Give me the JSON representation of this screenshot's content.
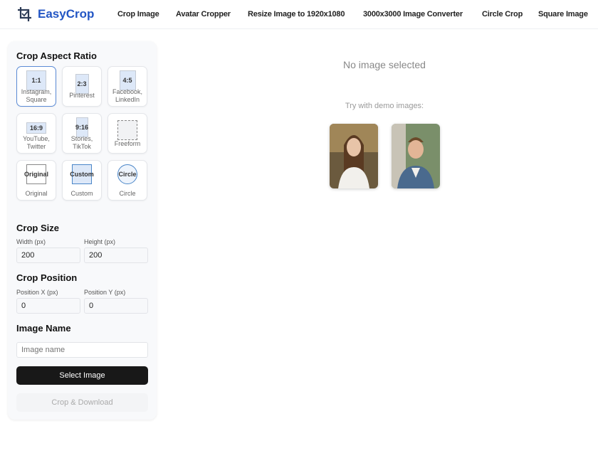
{
  "brand": {
    "name": "EasyCrop",
    "color": "#2356c4"
  },
  "nav": [
    "Crop Image",
    "Avatar Cropper",
    "Resize Image to 1920x1080",
    "3000x3000 Image Converter",
    "Circle Crop",
    "Square Image"
  ],
  "sidebar": {
    "aspect_title": "Crop Aspect Ratio",
    "ratios": [
      {
        "badge": "1:1",
        "label": "Instagram, Square",
        "selected": true
      },
      {
        "badge": "2:3",
        "label": "Pinterest"
      },
      {
        "badge": "4:5",
        "label": "Facebook, LinkedIn"
      },
      {
        "badge": "16:9",
        "label": "YouTube, Twitter"
      },
      {
        "badge": "9:16",
        "label": "Stories, TikTok"
      },
      {
        "badge": "",
        "label": "Freeform"
      },
      {
        "badge": "Original",
        "label": "Original"
      },
      {
        "badge": "Custom",
        "label": "Custom"
      },
      {
        "badge": "Circle",
        "label": "Circle"
      }
    ],
    "size_title": "Crop Size",
    "width_label": "Width (px)",
    "width_value": "200",
    "height_label": "Height (px)",
    "height_value": "200",
    "position_title": "Crop Position",
    "x_label": "Position X (px)",
    "x_value": "0",
    "y_label": "Position Y (px)",
    "y_value": "0",
    "name_title": "Image Name",
    "name_placeholder": "Image name",
    "select_button": "Select Image",
    "crop_button": "Crop & Download"
  },
  "main": {
    "empty_text": "No image selected",
    "demo_text": "Try with demo images:"
  }
}
